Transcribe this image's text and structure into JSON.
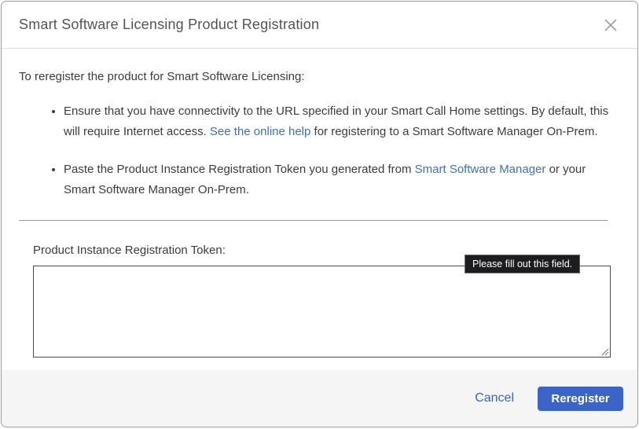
{
  "dialog": {
    "title": "Smart Software Licensing Product Registration"
  },
  "body": {
    "intro": "To reregister the product for Smart Software Licensing:",
    "bullets": [
      {
        "pre": "Ensure that you have connectivity to the URL specified in your Smart Call Home settings. By default, this will require Internet access. ",
        "link": "See the online help",
        "post": " for registering to a Smart Software Manager On-Prem."
      },
      {
        "pre": "Paste the Product Instance Registration Token you generated from ",
        "link": "Smart Software Manager",
        "post": " or your Smart Software Manager On-Prem."
      }
    ],
    "token_label": "Product Instance Registration Token:",
    "token_value": "",
    "validation_tooltip": "Please fill out this field."
  },
  "footer": {
    "cancel_label": "Cancel",
    "reregister_label": "Reregister"
  },
  "colors": {
    "link": "#3e6ec8",
    "primary_button": "#3b64c8",
    "footer_bg": "#f5f5f5",
    "tooltip_bg": "#1d1d1f"
  }
}
